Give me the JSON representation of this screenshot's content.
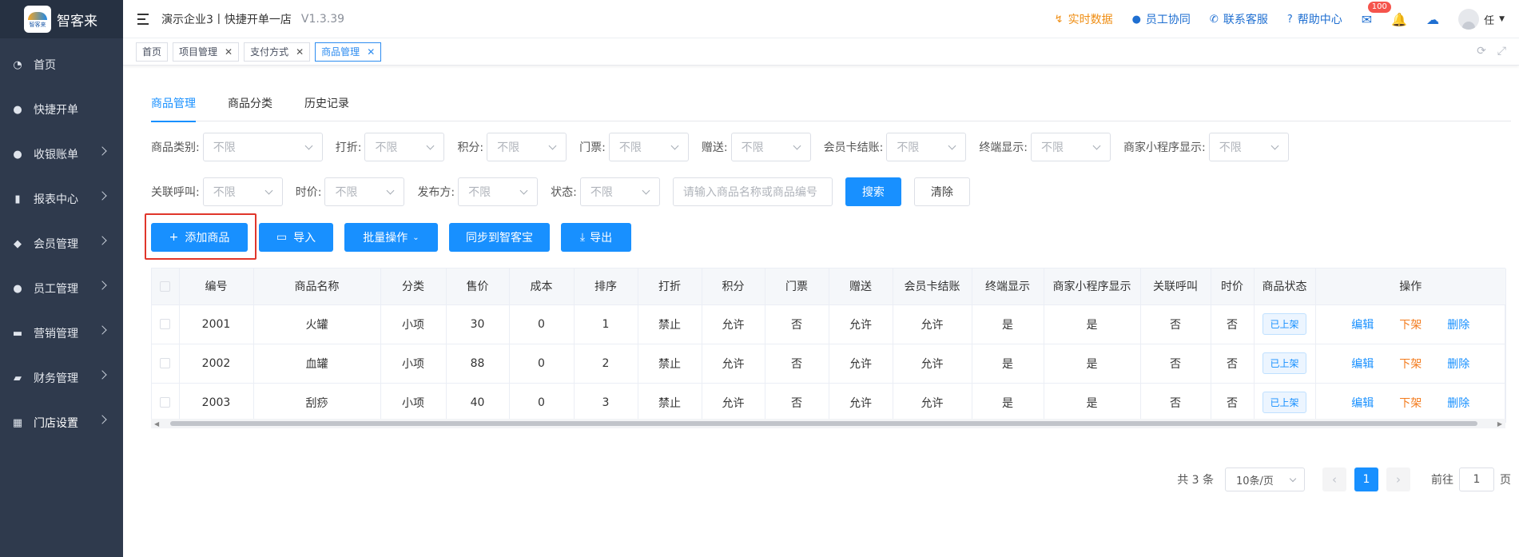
{
  "app": {
    "name": "智客来",
    "logo_text": "智客来"
  },
  "sidebar": {
    "items": [
      {
        "label": "首页",
        "icon": "dashboard-icon"
      },
      {
        "label": "快捷开单",
        "icon": "bag-icon"
      },
      {
        "label": "收银账单",
        "icon": "money-bag-icon"
      },
      {
        "label": "报表中心",
        "icon": "bar-chart-icon"
      },
      {
        "label": "会员管理",
        "icon": "diamond-icon"
      },
      {
        "label": "员工管理",
        "icon": "person-icon"
      },
      {
        "label": "营销管理",
        "icon": "briefcase-icon"
      },
      {
        "label": "财务管理",
        "icon": "wallet-icon"
      },
      {
        "label": "门店设置",
        "icon": "grid-icon"
      }
    ]
  },
  "header": {
    "store": "演示企业3丨快捷开单一店",
    "version": "V1.3.39",
    "realtime": "实时数据",
    "staff": "员工协同",
    "service": "联系客服",
    "help": "帮助中心",
    "mail_badge": "100",
    "user": "任"
  },
  "tabs": [
    {
      "label": "首页"
    },
    {
      "label": "项目管理"
    },
    {
      "label": "支付方式"
    },
    {
      "label": "商品管理"
    }
  ],
  "subtabs": [
    "商品管理",
    "商品分类",
    "历史记录"
  ],
  "filters": {
    "row1": [
      {
        "label": "商品类别:",
        "value": "不限"
      },
      {
        "label": "打折:",
        "value": "不限"
      },
      {
        "label": "积分:",
        "value": "不限"
      },
      {
        "label": "门票:",
        "value": "不限"
      },
      {
        "label": "赠送:",
        "value": "不限"
      },
      {
        "label": "会员卡结账:",
        "value": "不限"
      },
      {
        "label": "终端显示:",
        "value": "不限"
      },
      {
        "label": "商家小程序显示:",
        "value": "不限"
      }
    ],
    "row2": [
      {
        "label": "关联呼叫:",
        "value": "不限"
      },
      {
        "label": "时价:",
        "value": "不限"
      },
      {
        "label": "发布方:",
        "value": "不限"
      },
      {
        "label": "状态:",
        "value": "不限"
      }
    ],
    "search_placeholder": "请输入商品名称或商品编号",
    "search_btn": "搜索",
    "clear_btn": "清除"
  },
  "actions": {
    "add": "添加商品",
    "import": "导入",
    "batch": "批量操作",
    "sync": "同步到智客宝",
    "export": "导出"
  },
  "table": {
    "headers": [
      "编号",
      "商品名称",
      "分类",
      "售价",
      "成本",
      "排序",
      "打折",
      "积分",
      "门票",
      "赠送",
      "会员卡结账",
      "终端显示",
      "商家小程序显示",
      "关联呼叫",
      "时价",
      "商品状态",
      "操作"
    ],
    "rows": [
      {
        "cells": [
          "2001",
          "火罐",
          "小项",
          "30",
          "0",
          "1",
          "禁止",
          "允许",
          "否",
          "允许",
          "允许",
          "是",
          "是",
          "否",
          "否"
        ],
        "status": "已上架"
      },
      {
        "cells": [
          "2002",
          "血罐",
          "小项",
          "88",
          "0",
          "2",
          "禁止",
          "允许",
          "否",
          "允许",
          "允许",
          "是",
          "是",
          "否",
          "否"
        ],
        "status": "已上架"
      },
      {
        "cells": [
          "2003",
          "刮痧",
          "小项",
          "40",
          "0",
          "3",
          "禁止",
          "允许",
          "否",
          "允许",
          "允许",
          "是",
          "是",
          "否",
          "否"
        ],
        "status": "已上架"
      }
    ],
    "ops": {
      "edit": "编辑",
      "offshelf": "下架",
      "delete": "删除"
    }
  },
  "pagination": {
    "total": "共 3 条",
    "page_size": "10条/页",
    "current": "1",
    "goto_label": "前往",
    "goto_value": "1",
    "page_suffix": "页"
  }
}
